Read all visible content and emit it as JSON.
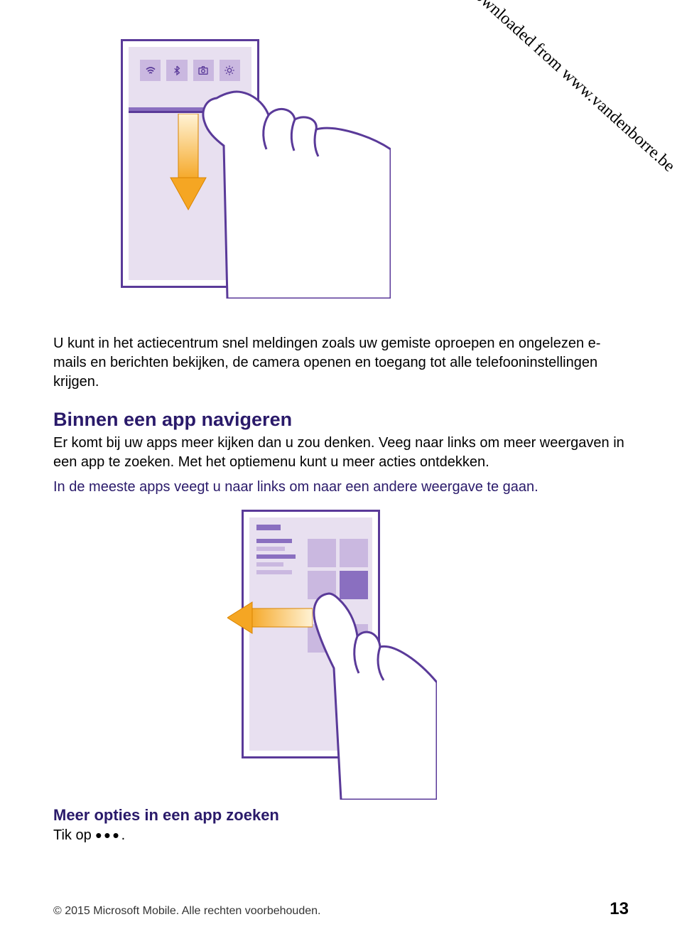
{
  "watermark": "Downloaded from www.vandenborre.be",
  "icons": {
    "wifi": "wifi-icon",
    "bluetooth": "bluetooth-icon",
    "camera": "camera-icon",
    "brightness": "brightness-icon"
  },
  "paragraph1": "U kunt in het actiecentrum snel meldingen zoals uw gemiste oproepen en ongelezen e-mails en berichten bekijken, de camera openen en toegang tot alle telefooninstellingen krijgen.",
  "heading1": "Binnen een app navigeren",
  "subtext1": "Er komt bij uw apps meer kijken dan u zou denken. Veeg naar links om meer weergaven in een app te zoeken. Met het optiemenu kunt u meer acties ontdekken.",
  "highlight1": "In de meeste apps veegt u naar links om naar een andere weergave te gaan.",
  "heading2": "Meer opties in een app zoeken",
  "tik_prefix": "Tik op ",
  "tik_suffix": ".",
  "footer": {
    "copyright": "© 2015 Microsoft Mobile. Alle rechten voorbehouden.",
    "page": "13"
  }
}
